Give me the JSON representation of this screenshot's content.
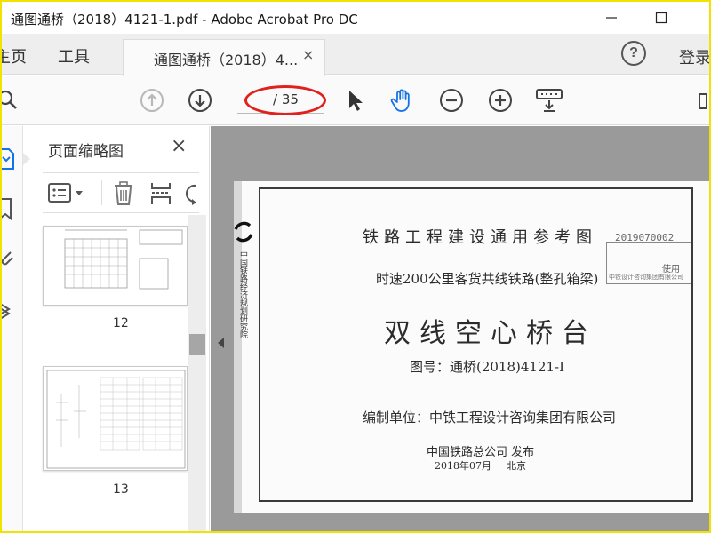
{
  "window": {
    "title": "通图通桥（2018）4121-1.pdf - Adobe Acrobat Pro DC"
  },
  "menu": {
    "home_label": "主页",
    "tools_label": "工具",
    "doc_tab_label": "通图通桥（2018）4...",
    "doc_tab_close": "×",
    "help_label": "?",
    "login_label": "登录"
  },
  "toolbar": {
    "page_current": "",
    "page_total": "/ 35",
    "icons": [
      "search-icon",
      "page-up-icon",
      "page-down-icon",
      "select-arrow-icon",
      "hand-icon",
      "zoom-out-icon",
      "zoom-in-icon",
      "keyboard-icon"
    ],
    "accent_color": "#1473e6",
    "highlight_color": "#e0211d"
  },
  "thumbnails": {
    "title": "页面缩略图",
    "close_label": "×",
    "pages": [
      {
        "label": "12"
      },
      {
        "label": "13"
      }
    ]
  },
  "document": {
    "main_title": "铁路工程建设通用参考图",
    "subtitle": "时速200公里客货共线铁路(整孔箱梁)",
    "big_title": "双线空心桥台",
    "drawing_no": "图号：通桥(2018)4121-Ⅰ",
    "compiler": "编制单位：中铁工程设计咨询集团有限公司",
    "publisher": "中国铁路总公司   发布",
    "date": "2018年07月",
    "city": "北京",
    "stamp_number": "2019070002",
    "stamp_text": "使用",
    "stamp_small": "中铁设计咨询集团有限公司",
    "side_text": "中国铁路经济规划研究院"
  }
}
